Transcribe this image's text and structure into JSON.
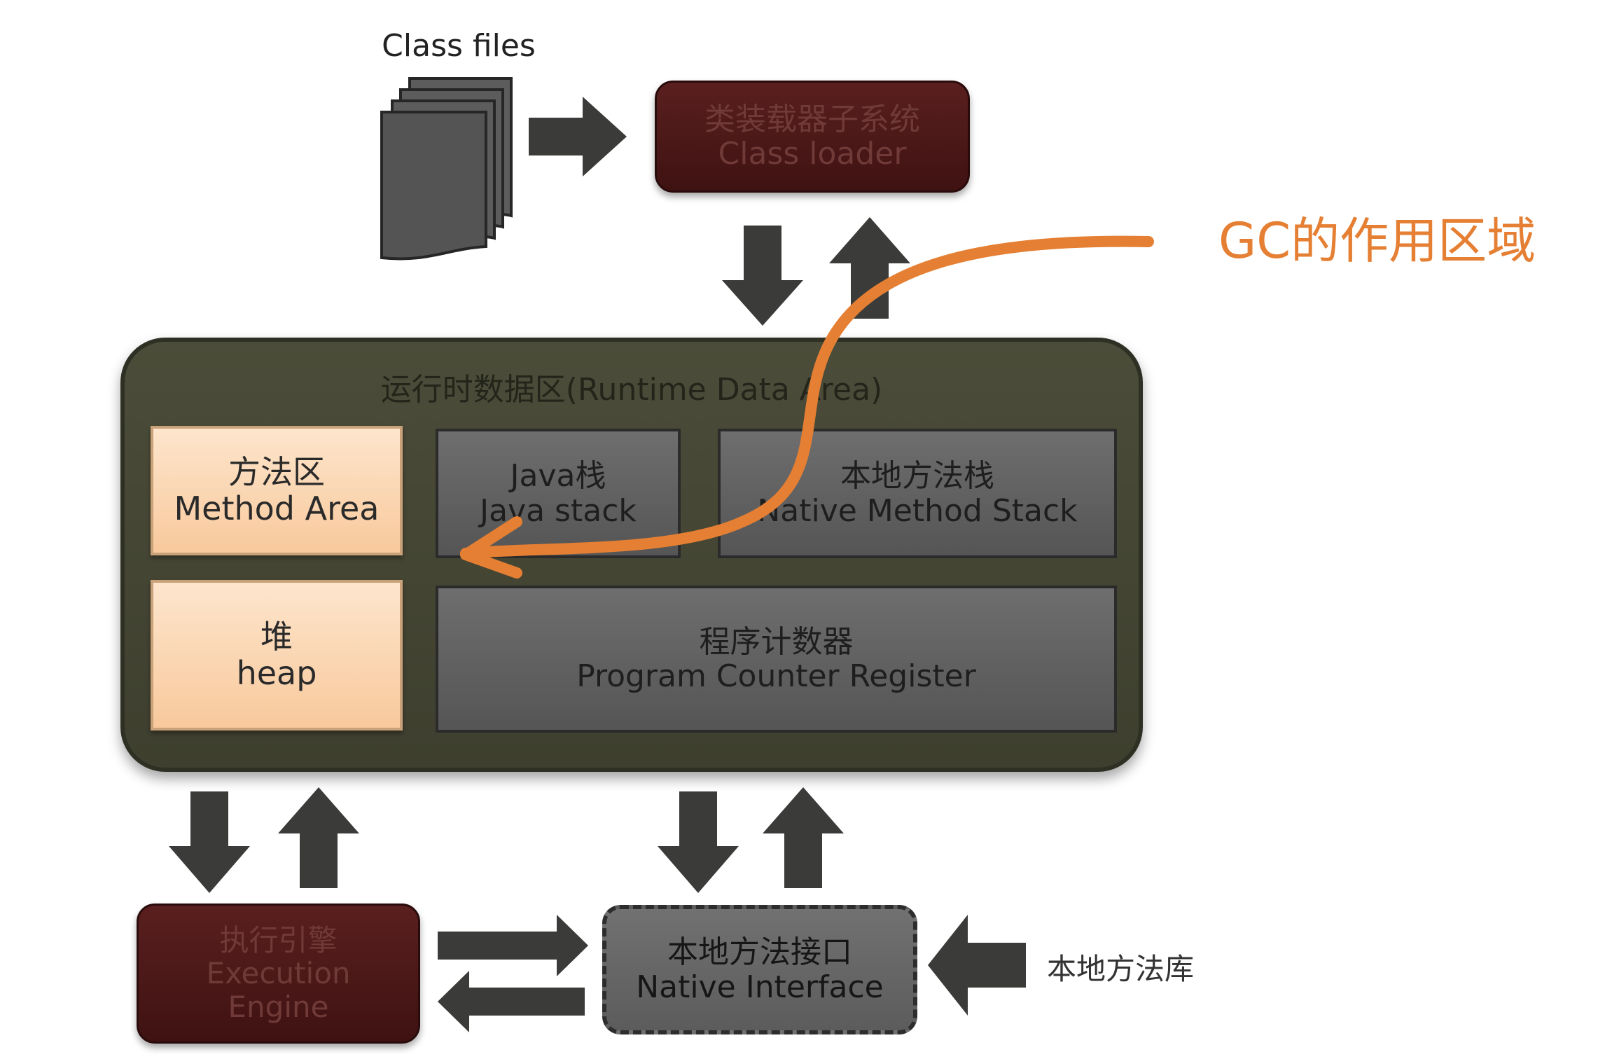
{
  "class_files": {
    "label": "Class files"
  },
  "class_loader": {
    "line1": "类装载器子系统",
    "line2": "Class loader"
  },
  "gc_label": "GC的作用区域",
  "runtime": {
    "title": "运行时数据区(Runtime Data Area)",
    "method_area": {
      "line1": "方法区",
      "line2": "Method Area"
    },
    "java_stack": {
      "line1": "Java栈",
      "line2": "Java stack"
    },
    "native_stack": {
      "line1": "本地方法栈",
      "line2": "Native Method Stack"
    },
    "heap": {
      "line1": "堆",
      "line2": "heap"
    },
    "pc_register": {
      "line1": "程序计数器",
      "line2": "Program Counter Register"
    }
  },
  "execution_engine": {
    "line1": "执行引擎",
    "line2": "Execution",
    "line3": "Engine"
  },
  "native_interface": {
    "line1": "本地方法接口",
    "line2": "Native Interface"
  },
  "native_library": {
    "label": "本地方法库"
  },
  "colors": {
    "gc_accent": "#e57f33",
    "arrow": "#3b3c39",
    "runtime_bg": "#45463a",
    "peach": "#fbd8b4",
    "maroon": "#4a1818"
  }
}
